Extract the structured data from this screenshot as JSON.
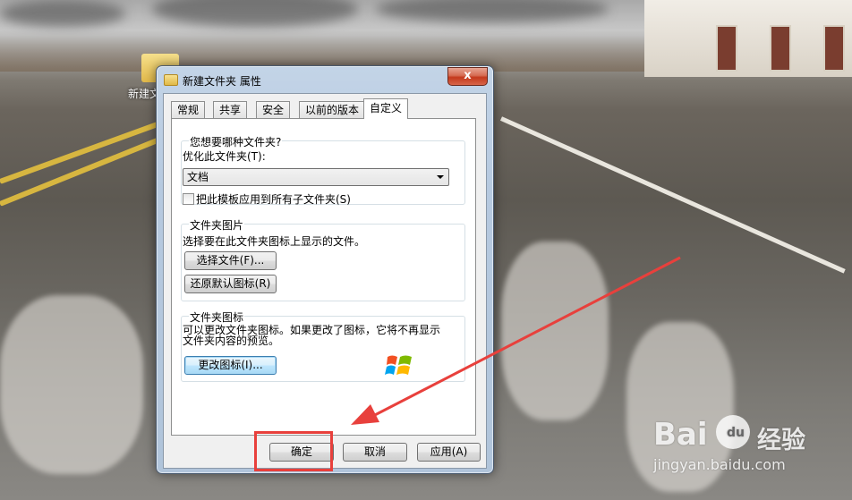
{
  "desktop": {
    "folder_label": "新建文"
  },
  "window": {
    "title": "新建文件夹 属性",
    "close_glyph": "x",
    "tabs": [
      {
        "label": "常规"
      },
      {
        "label": "共享"
      },
      {
        "label": "安全"
      },
      {
        "label": "以前的版本"
      },
      {
        "label": "自定义",
        "active": true
      }
    ],
    "folder_type": {
      "group_title": "您想要哪种文件夹?",
      "optimize_label": "优化此文件夹(T):",
      "selected_value": "文档",
      "apply_checkbox_label": "把此模板应用到所有子文件夹(S)",
      "apply_checked": false
    },
    "folder_pictures": {
      "group_title": "文件夹图片",
      "description": "选择要在此文件夹图标上显示的文件。",
      "choose_file_button": "选择文件(F)...",
      "restore_default_button": "还原默认图标(R)"
    },
    "folder_icons": {
      "group_title": "文件夹图标",
      "description_line1": "可以更改文件夹图标。如果更改了图标，它将不再显示",
      "description_line2": "文件夹内容的预览。",
      "change_icon_button": "更改图标(I)...",
      "icon": "windows-flag-icon"
    },
    "footer": {
      "ok_button": "确定",
      "cancel_button": "取消",
      "apply_button": "应用(A)"
    }
  },
  "annotation": {
    "color": "#e8403c"
  },
  "watermark": {
    "brand_text": "Bai",
    "brand_suffix": "du",
    "cn_text": "经验",
    "url_text": "jingyan.baidu.com"
  }
}
